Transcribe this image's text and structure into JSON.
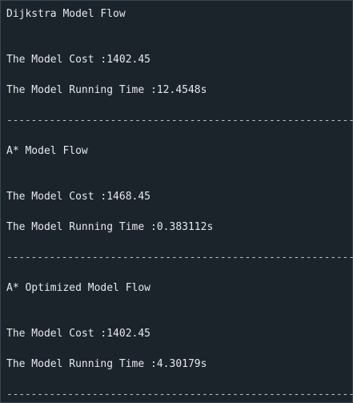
{
  "sections": [
    {
      "title": "Dijkstra Model Flow",
      "cost_line": "The Model Cost :1402.45",
      "time_line": "The Model Running Time :12.4548s"
    },
    {
      "title": "A* Model Flow",
      "cost_line": "The Model Cost :1468.45",
      "time_line": "The Model Running Time :0.383112s"
    },
    {
      "title": "A* Optimized Model Flow",
      "cost_line": "The Model Cost :1402.45",
      "time_line": "The Model Running Time :4.30179s"
    }
  ],
  "divider": "-----------------------------------------------------------"
}
